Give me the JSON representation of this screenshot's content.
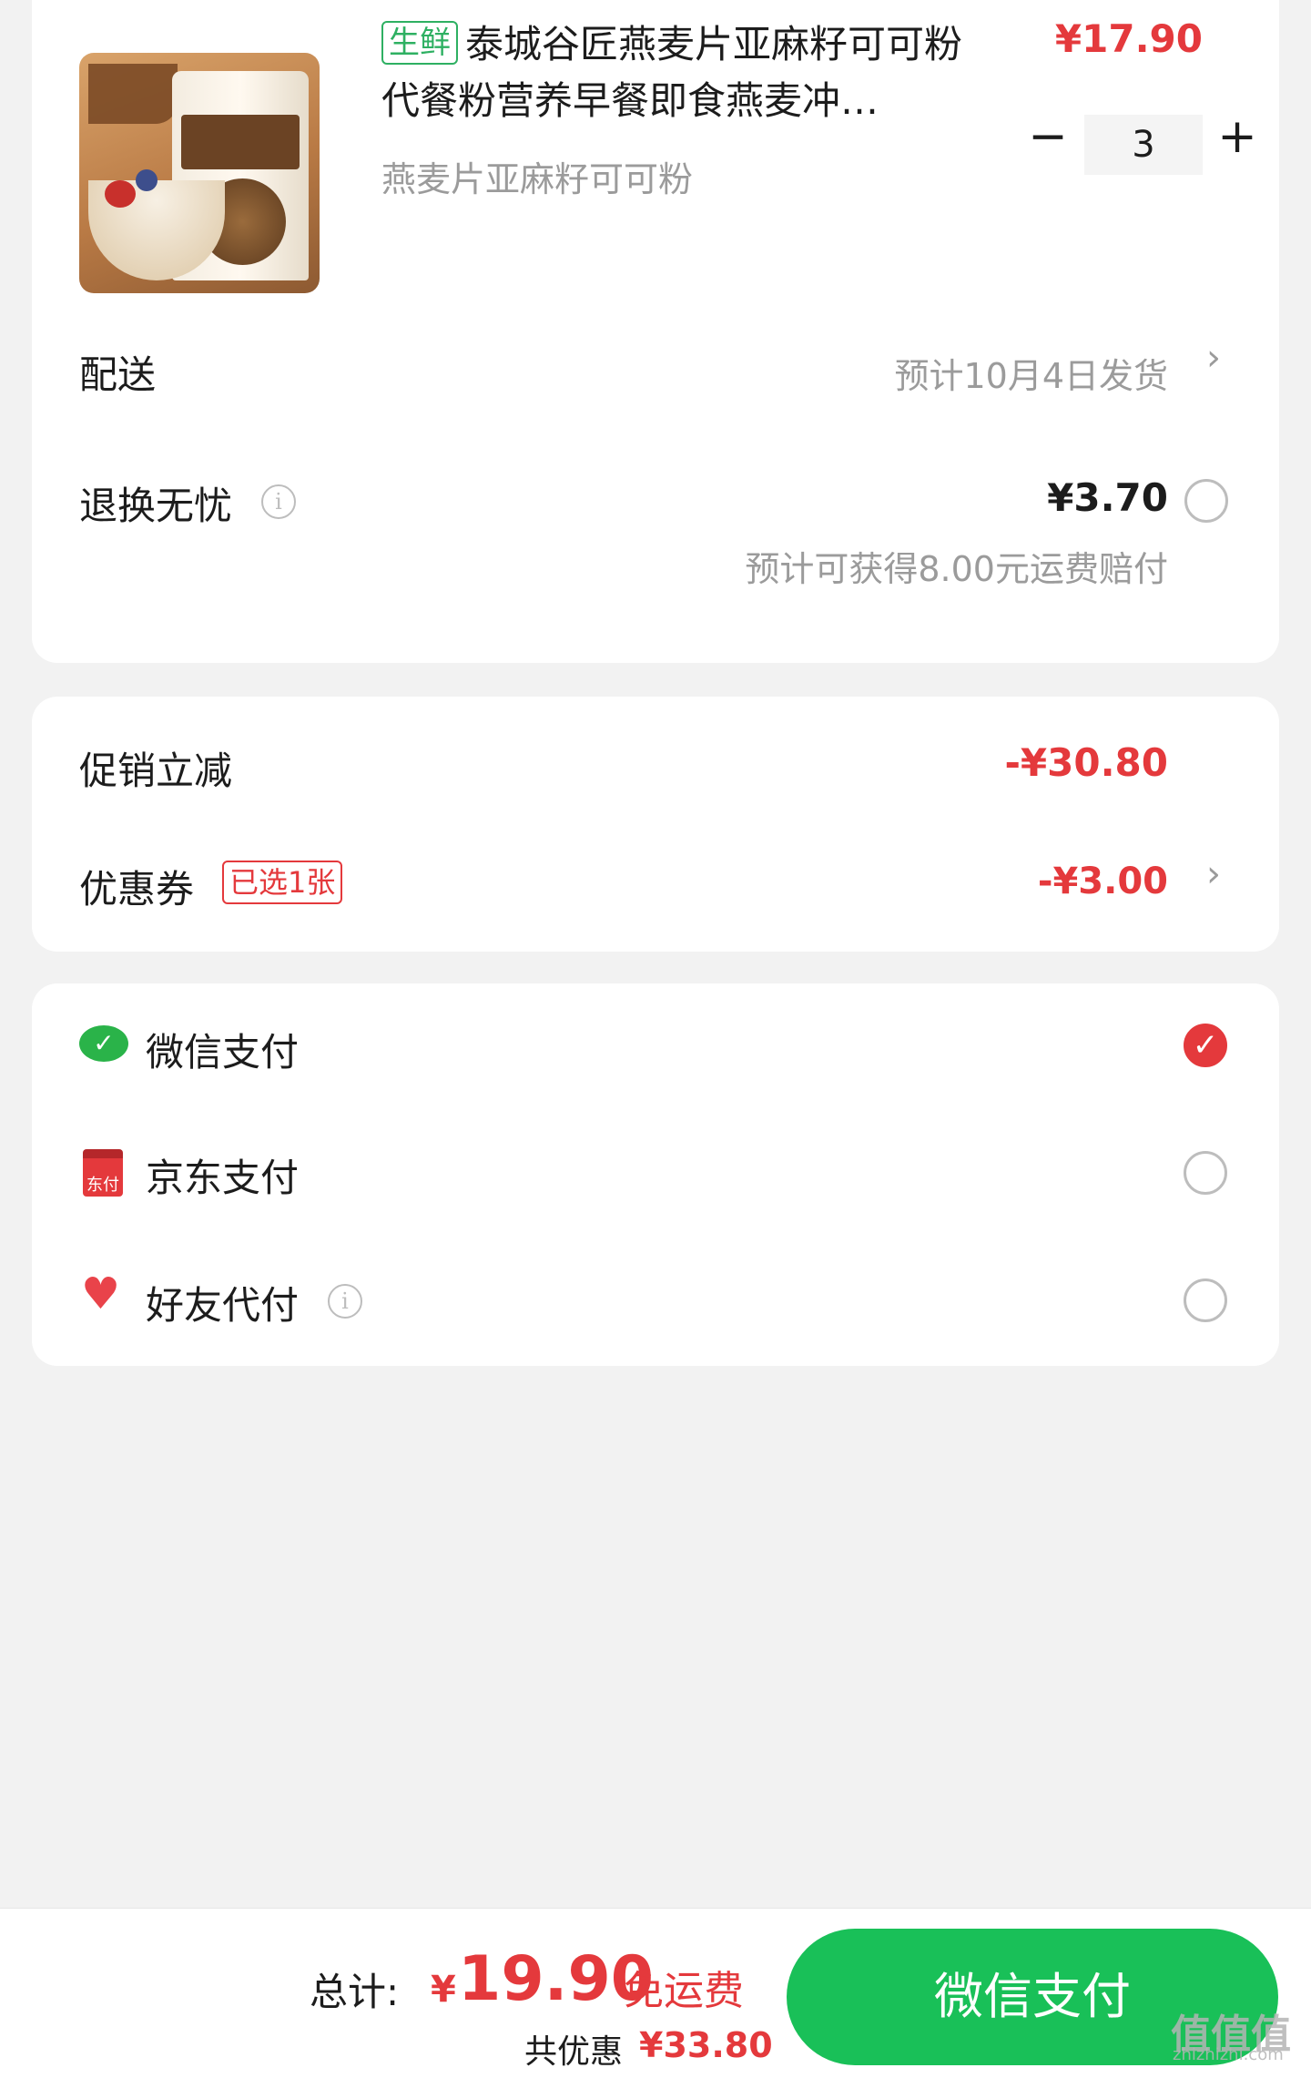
{
  "product": {
    "tag": "生鲜",
    "title": "泰城谷匠燕麦片亚麻籽可可粉代餐粉营养早餐即食燕麦冲…",
    "sku": "燕麦片亚麻籽可可粉",
    "price": "¥17.90",
    "quantity": "3",
    "minus": "−",
    "plus": "+"
  },
  "delivery": {
    "label": "配送",
    "value": "预计10月4日发货",
    "chevron": "›"
  },
  "return_insurance": {
    "label": "退换无忧",
    "price": "¥3.70",
    "note": "预计可获得8.00元运费赔付"
  },
  "discounts": {
    "promo_label": "促销立减",
    "promo_value": "-¥30.80",
    "coupon_label": "优惠券",
    "coupon_tag": "已选1张",
    "coupon_value": "-¥3.00",
    "chevron": "›"
  },
  "payment_methods": [
    {
      "label": "微信支付",
      "selected": true
    },
    {
      "label": "京东支付",
      "selected": false
    },
    {
      "label": "好友代付",
      "selected": false
    }
  ],
  "icons": {
    "info": "i",
    "check": "✓",
    "wechat": "wechat-icon",
    "jd_pay": "jd-pay-icon",
    "friend_pay": "heart-icon",
    "jd_text": "东付"
  },
  "footer": {
    "total_label": "总计:",
    "currency": "¥",
    "total_amount": "19.90",
    "free_shipping": "免运费",
    "saving_label": "共优惠",
    "saving_amount": "¥33.80",
    "pay_button": "微信支付"
  },
  "watermark": {
    "text": "值值值",
    "sub": "zhizhizhi.com"
  },
  "colors": {
    "accent_red": "#e4393c",
    "pay_green": "#19c058",
    "fresh_green": "#2eb062"
  }
}
